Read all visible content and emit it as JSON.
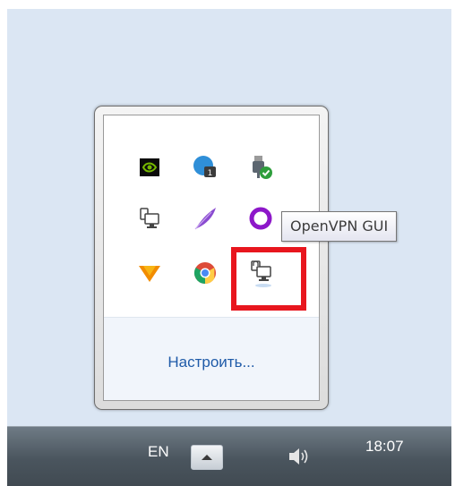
{
  "tray_flyout": {
    "icons": [
      {
        "name": "nvidia-icon"
      },
      {
        "name": "onedrive-cloud-icon",
        "badge": "1"
      },
      {
        "name": "safely-remove-hardware-icon"
      },
      {
        "name": "network-icon"
      },
      {
        "name": "feather-icon"
      },
      {
        "name": "ring-icon"
      },
      {
        "name": "winamp-w-icon"
      },
      {
        "name": "chrome-icon"
      },
      {
        "name": "openvpn-gui-icon"
      }
    ],
    "customize_label": "Настроить..."
  },
  "tooltip": {
    "text": "OpenVPN GUI"
  },
  "taskbar": {
    "language": "EN",
    "clock": "18:07"
  },
  "colors": {
    "highlight": "#e8161e",
    "link": "#1e5aa8",
    "taskbar": "#4a555e"
  }
}
